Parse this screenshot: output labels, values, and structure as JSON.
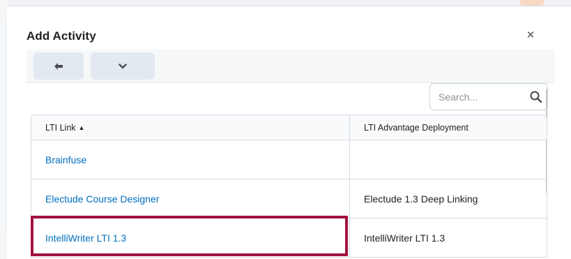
{
  "dialog": {
    "title": "Add Activity",
    "close_glyph": "×"
  },
  "toolbar": {
    "back_icon": "arrow-left-icon",
    "more_icon": "chevron-down-icon"
  },
  "search": {
    "placeholder": "Search...",
    "value": ""
  },
  "table": {
    "columns": [
      "LTI Link",
      "LTI Advantage Deployment"
    ],
    "sort_glyph": "▲",
    "rows": [
      {
        "link": "Brainfuse",
        "deployment": ""
      },
      {
        "link": "Electude Course Designer",
        "deployment": "Electude 1.3 Deep Linking"
      },
      {
        "link": "IntelliWriter LTI 1.3",
        "deployment": "IntelliWriter LTI 1.3"
      }
    ]
  },
  "colors": {
    "link": "#006fbf",
    "highlight": "#a3123e",
    "toolbar_bg": "#f6f7f8",
    "button_bg": "#e3e9f1"
  }
}
